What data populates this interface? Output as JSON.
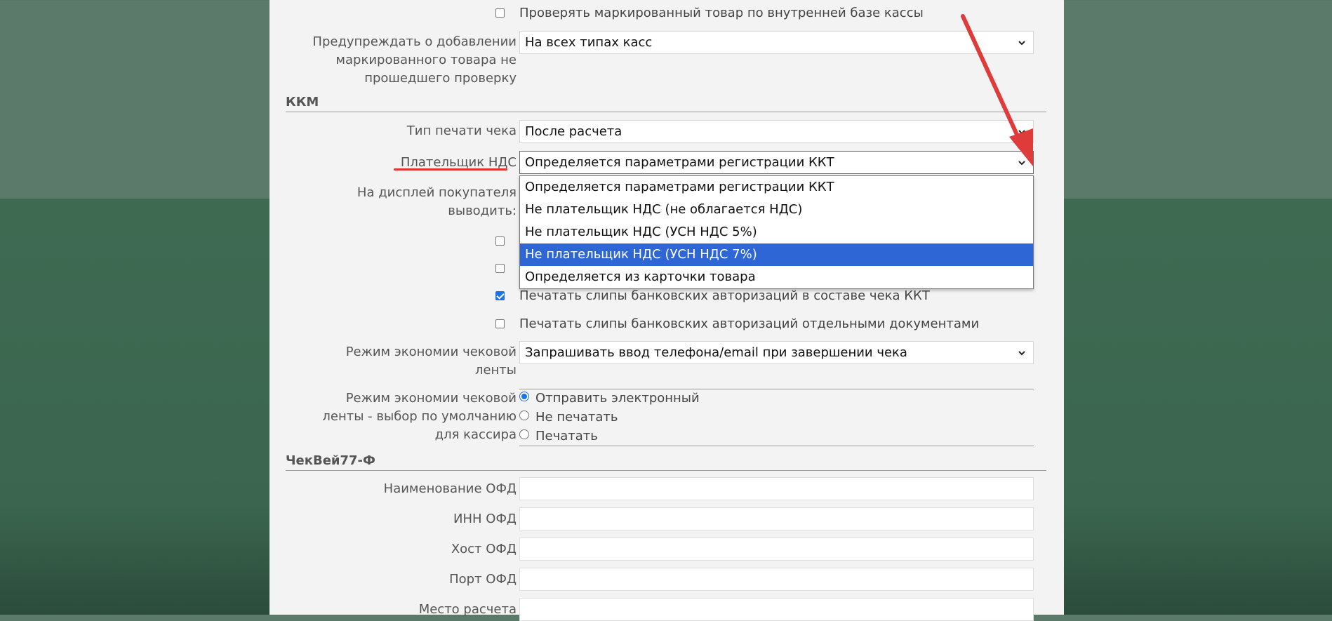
{
  "top_checkbox": {
    "label": "Проверять маркированный товар по внутренней базе кассы",
    "checked": false
  },
  "warn_marked": {
    "label_lines": [
      "Предупреждать о добавлении",
      "маркированного товара не",
      "прошедшего проверку"
    ],
    "value": "На всех типах касс"
  },
  "section_kkm": "ККМ",
  "print_type": {
    "label": "Тип печати чека",
    "value": "После расчета"
  },
  "vat_payer": {
    "label": "Плательщик НДС",
    "value": "Определяется параметрами регистрации ККТ",
    "options": [
      "Определяется параметрами регистрации ККТ",
      "Не плательщик НДС (не облагается НДС)",
      "Не плательщик НДС (УСН НДС 5%)",
      "Не плательщик НДС (УСН НДС 7%)",
      "Определяется из карточки товара"
    ],
    "highlighted_index": 3
  },
  "customer_display": {
    "label_lines": [
      "На дисплей покупателя",
      "выводить:"
    ]
  },
  "hidden_checkboxes": [
    {
      "checked": false
    },
    {
      "checked": false
    }
  ],
  "slips_in_receipt": {
    "label": "Печатать слипы банковских авторизаций в составе чека ККТ",
    "checked": true
  },
  "slips_separate": {
    "label": "Печатать слипы банковских авторизаций отдельными документами",
    "checked": false
  },
  "economy_mode": {
    "label_lines": [
      "Режим экономии чековой",
      "ленты"
    ],
    "value": "Запрашивать ввод телефона/email при завершении чека"
  },
  "economy_default": {
    "label_lines": [
      "Режим экономии чековой",
      "ленты - выбор по умолчанию",
      "для кассира"
    ],
    "options": [
      "Отправить электронный",
      "Не печатать",
      "Печатать"
    ],
    "selected_index": 0
  },
  "section_checkway": "ЧекВей77-Ф",
  "ofd_fields": [
    {
      "label": "Наименование ОФД",
      "value": ""
    },
    {
      "label": "ИНН ОФД",
      "value": ""
    },
    {
      "label": "Хост ОФД",
      "value": ""
    },
    {
      "label": "Порт ОФД",
      "value": ""
    },
    {
      "label": "Место расчета",
      "value": ""
    }
  ],
  "colors": {
    "accent": "#2e66d6",
    "annotation_red": "#dd3333",
    "panel_bg": "#f3f3f3",
    "page_bg_top": "#5b7a69",
    "page_bg_bottom": "#3f6a52"
  },
  "icons": {
    "select_arrow": "chevron-down-icon",
    "annotation": "red-arrow-annotation"
  }
}
